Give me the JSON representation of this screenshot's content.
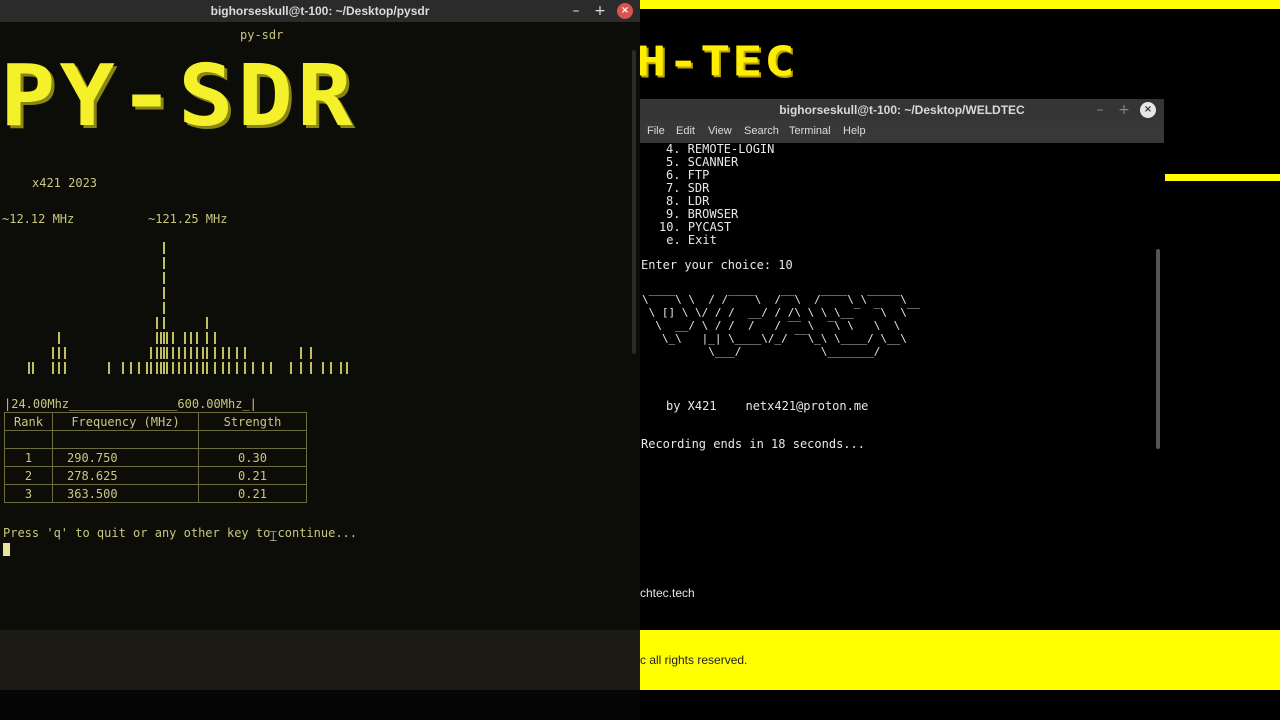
{
  "background_page": {
    "logo_text": "H-TEC",
    "site_link": "chtec.tech",
    "footer_text": "c all rights reserved.",
    "accent_color": "#ffff00"
  },
  "win1": {
    "title": "bighorseskull@t-100: ~/Desktop/pysdr",
    "controls": {
      "minimize": "–",
      "maximize": "+",
      "close": "×"
    },
    "banner_title": "py-sdr",
    "banner": "PY-SDR",
    "subtitle": "x421 2023",
    "freq_left": "~12.12 MHz",
    "freq_right": "~121.25 MHz",
    "range_line": "|24.00Mhz_______________600.00Mhz_|",
    "table": {
      "headers": [
        "Rank",
        "Frequency (MHz)",
        "Strength"
      ],
      "rows": [
        {
          "rank": "1",
          "freq": "290.750",
          "strength": "0.30"
        },
        {
          "rank": "2",
          "freq": "278.625",
          "strength": "0.21"
        },
        {
          "rank": "3",
          "freq": "363.500",
          "strength": "0.21"
        }
      ]
    },
    "prompt": "Press 'q' to quit or any other key to continue..."
  },
  "win2": {
    "title": "bighorseskull@t-100: ~/Desktop/WELDTEC",
    "menu": [
      "File",
      "Edit",
      "View",
      "Search",
      "Terminal",
      "Help"
    ],
    "menu_items": [
      "4. REMOTE-LOGIN",
      "5. SCANNER",
      "6. FTP",
      "7. SDR",
      "8. LDR",
      "9. BROWSER",
      "10. PYCAST",
      " e. Exit"
    ],
    "choice_prompt": "Enter your choice: 10",
    "byline": "by X421    netx421@proton.me",
    "recording": "Recording ends in 18 seconds..."
  }
}
